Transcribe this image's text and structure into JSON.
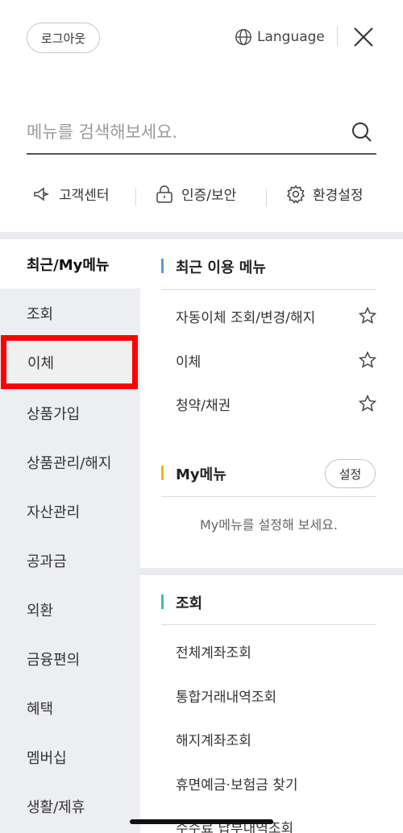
{
  "header": {
    "logout_label": "로그아웃",
    "language_label": "Language"
  },
  "search": {
    "placeholder": "메뉴를 검색해보세요."
  },
  "quick_links": [
    {
      "label": "고객센터",
      "icon": "megaphone-icon"
    },
    {
      "label": "인증/보안",
      "icon": "lock-icon"
    },
    {
      "label": "환경설정",
      "icon": "gear-icon"
    }
  ],
  "categories": [
    {
      "label": "최근/My메뉴"
    },
    {
      "label": "조회"
    },
    {
      "label": "이체"
    },
    {
      "label": "상품가입"
    },
    {
      "label": "상품관리/해지"
    },
    {
      "label": "자산관리"
    },
    {
      "label": "공과금"
    },
    {
      "label": "외환"
    },
    {
      "label": "금융편의"
    },
    {
      "label": "혜택"
    },
    {
      "label": "멤버십"
    },
    {
      "label": "생활/제휴"
    }
  ],
  "recent": {
    "title": "최근 이용 메뉴",
    "accent": "#5b9bd5",
    "items": [
      {
        "label": "자동이체 조회/변경/해지"
      },
      {
        "label": "이체"
      },
      {
        "label": "청약/채권"
      }
    ]
  },
  "my_menu": {
    "title": "My메뉴",
    "accent": "#f5b700",
    "setting_label": "설정",
    "empty_text": "My메뉴를 설정해 보세요."
  },
  "inquiry": {
    "title": "조회",
    "accent": "#3fbfad",
    "items": [
      {
        "label": "전체계좌조회"
      },
      {
        "label": "통합거래내역조회"
      },
      {
        "label": "해지계좌조회"
      },
      {
        "label": "휴면예금·보험금 찾기"
      },
      {
        "label": "수수료 납부내역조회"
      }
    ]
  },
  "highlight_color": "#ff0000"
}
